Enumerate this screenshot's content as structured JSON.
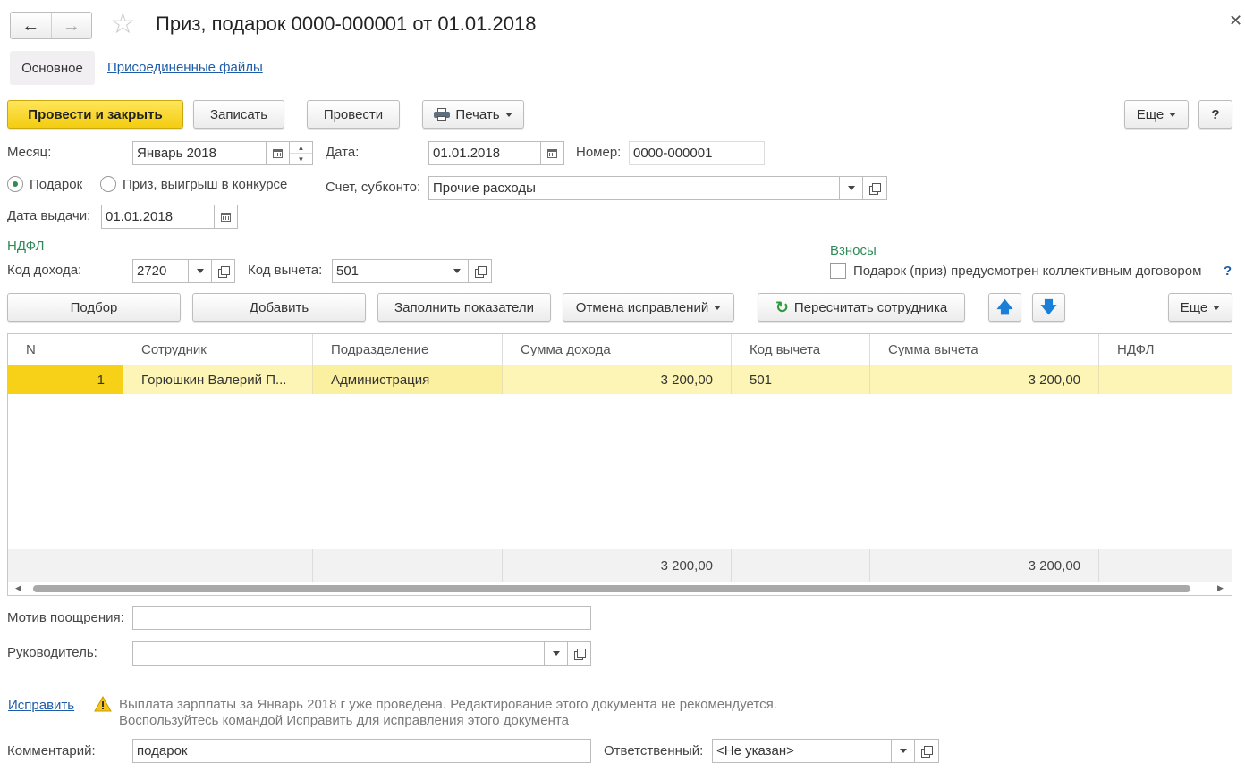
{
  "title": "Приз, подарок 0000-000001 от 01.01.2018",
  "tabs": [
    "Основное",
    "Присоединенные файлы"
  ],
  "toolbar": {
    "post_close": "Провести и закрыть",
    "save": "Записать",
    "post": "Провести",
    "print": "Печать",
    "more": "Еще",
    "help": "?"
  },
  "form": {
    "month_label": "Месяц:",
    "month_value": "Январь 2018",
    "date_label": "Дата:",
    "date_value": "01.01.2018",
    "number_label": "Номер:",
    "number_value": "0000-000001",
    "radio_gift": "Подарок",
    "radio_prize": "Приз, выигрыш в конкурсе",
    "account_label": "Счет, субконто:",
    "account_value": "Прочие расходы",
    "issue_date_label": "Дата выдачи:",
    "issue_date_value": "01.01.2018",
    "ndfl_header": "НДФЛ",
    "income_code_label": "Код дохода:",
    "income_code_value": "2720",
    "deduction_code_label": "Код вычета:",
    "deduction_code_value": "501",
    "contrib_header": "Взносы",
    "contrib_checkbox": "Подарок (приз) предусмотрен коллективным договором",
    "contrib_help": "?"
  },
  "table_toolbar": {
    "pick": "Подбор",
    "add": "Добавить",
    "fill": "Заполнить показатели",
    "cancel_fix": "Отмена исправлений",
    "recalc": "Пересчитать сотрудника",
    "more": "Еще"
  },
  "table": {
    "columns": [
      "N",
      "Сотрудник",
      "Подразделение",
      "Сумма дохода",
      "Код вычета",
      "Сумма вычета",
      "НДФЛ"
    ],
    "rows": [
      [
        "1",
        "Горюшкин Валерий П...",
        "Администрация",
        "3 200,00",
        "501",
        "3 200,00",
        ""
      ]
    ],
    "totals": [
      "",
      "",
      "",
      "3 200,00",
      "",
      "3 200,00",
      ""
    ]
  },
  "bottom": {
    "motive_label": "Мотив поощрения:",
    "motive_value": "",
    "manager_label": "Руководитель:",
    "manager_value": "",
    "fix_link": "Исправить",
    "warning_line1": "Выплата зарплаты за Январь 2018 г уже проведена. Редактирование этого документа не рекомендуется.",
    "warning_line2": "Воспользуйтесь командой Исправить для исправления этого документа",
    "comment_label": "Комментарий:",
    "comment_value": "подарок",
    "responsible_label": "Ответственный:",
    "responsible_value": "<Не указан>"
  },
  "colors": {
    "primary_button": "#f3cd10",
    "selected_row": "#fdf5b5",
    "row_number_cell": "#f7d117",
    "link": "#1e5ca8",
    "section_header": "#2e8b57",
    "warning_text": "#7a7a7a"
  }
}
